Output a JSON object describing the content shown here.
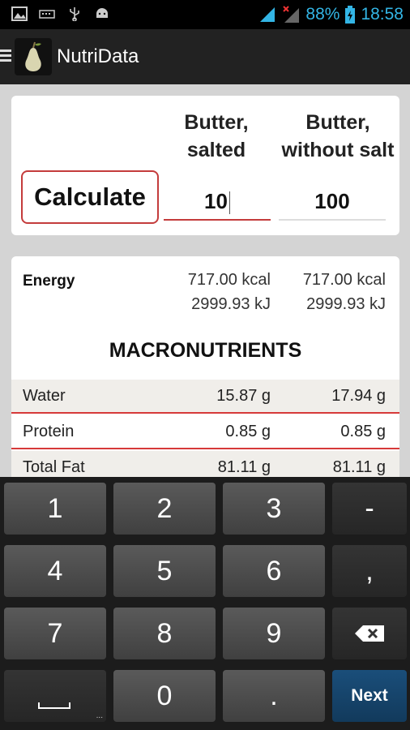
{
  "status_bar": {
    "battery": "88%",
    "time": "18:58"
  },
  "app": {
    "title": "NutriData"
  },
  "calculator": {
    "button_label": "Calculate",
    "foods": [
      {
        "name_line1": "Butter,",
        "name_line2": "salted",
        "quantity": "10"
      },
      {
        "name_line1": "Butter,",
        "name_line2": "without salt",
        "quantity": "100"
      }
    ]
  },
  "energy": {
    "label": "Energy",
    "values": [
      {
        "kcal": "717.00 kcal",
        "kj": "2999.93 kJ"
      },
      {
        "kcal": "717.00 kcal",
        "kj": "2999.93 kJ"
      }
    ]
  },
  "macronutrients": {
    "title": "MACRONUTRIENTS",
    "rows": [
      {
        "label": "Water",
        "v1": "15.87 g",
        "v2": "17.94 g"
      },
      {
        "label": "Protein",
        "v1": "0.85 g",
        "v2": "0.85 g"
      },
      {
        "label": "Total Fat",
        "v1": "81.11 g",
        "v2": "81.11 g"
      }
    ]
  },
  "keyboard": {
    "keys": [
      "1",
      "2",
      "3",
      "-",
      "4",
      "5",
      "6",
      ",",
      "7",
      "8",
      "9",
      "0",
      ".",
      "Next"
    ]
  },
  "colors": {
    "accent_red": "#c43c3c",
    "status_blue": "#33b5e5",
    "next_key": "#1a4e7a"
  }
}
